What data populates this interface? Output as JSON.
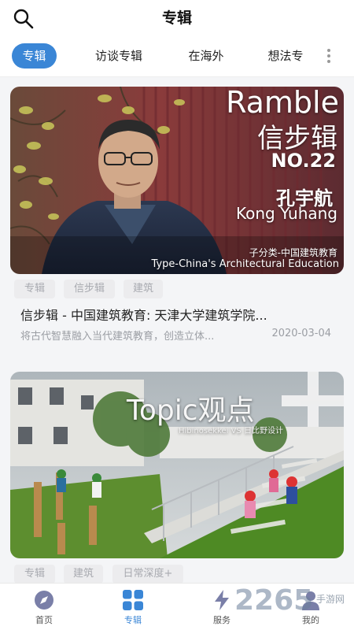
{
  "header": {
    "title": "专辑"
  },
  "tabs": [
    {
      "label": "专辑",
      "active": true
    },
    {
      "label": "访谈专辑",
      "active": false
    },
    {
      "label": "在海外",
      "active": false
    },
    {
      "label": "想法专",
      "active": false
    }
  ],
  "cards": [
    {
      "overlay": {
        "ramble": "Ramble",
        "series_cn": "信步辑",
        "number": "NO.22",
        "name_cn": "孔宇航",
        "name_en": "Kong Yuhang",
        "subtype_cn": "子分类-中国建筑教育",
        "subtype_en": "Type-China's Architectural Education"
      },
      "tags": [
        "专辑",
        "信步辑",
        "建筑"
      ],
      "title": "信步辑 - 中国建筑教育: 天津大学建筑学院...",
      "desc": "将古代智慧融入当代建筑教育，创造立体...",
      "date": "2020-03-04"
    },
    {
      "overlay": {
        "topic": "Topic观点",
        "subtitle": "Hibinosekkei VS 日比野设计"
      },
      "tags": [
        "专辑",
        "建筑",
        "日常深度+"
      ]
    }
  ],
  "bottom_nav": [
    {
      "label": "首页",
      "icon": "compass-icon",
      "active": false
    },
    {
      "label": "专辑",
      "icon": "grid-icon",
      "active": true
    },
    {
      "label": "服务",
      "icon": "lightning-icon",
      "active": false
    },
    {
      "label": "我的",
      "icon": "user-icon",
      "active": false
    }
  ],
  "watermark": {
    "number": "2265",
    "site": "手游网"
  },
  "colors": {
    "accent": "#3a86d6",
    "tag_bg": "#ececee",
    "text_muted": "#9b9ea4"
  }
}
